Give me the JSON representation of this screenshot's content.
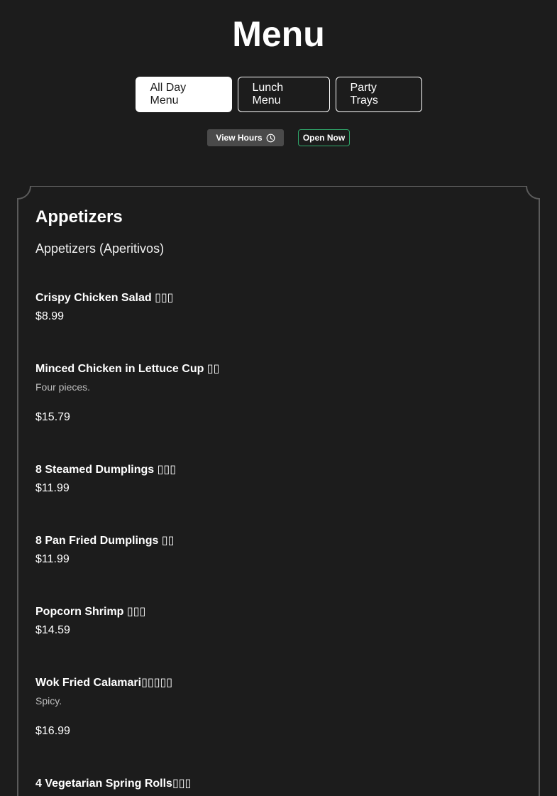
{
  "header": {
    "title": "Menu"
  },
  "tabs": [
    {
      "label": "All Day Menu",
      "active": true
    },
    {
      "label": "Lunch Menu",
      "active": false
    },
    {
      "label": "Party Trays",
      "active": false
    }
  ],
  "hours": {
    "label": "View Hours",
    "icon": "clock-icon"
  },
  "status": {
    "label": "Open Now",
    "color": "#2fa86b"
  },
  "section": {
    "title": "Appetizers",
    "subtitle": "Appetizers (Aperitivos)",
    "items": [
      {
        "name": "Crispy Chicken Salad ▯▯▯",
        "description": "",
        "price": "$8.99"
      },
      {
        "name": "Minced Chicken in Lettuce Cup ▯▯",
        "description": "Four pieces.",
        "price": "$15.79"
      },
      {
        "name": "8 Steamed Dumplings ▯▯▯",
        "description": "",
        "price": "$11.99"
      },
      {
        "name": "8 Pan Fried Dumplings ▯▯",
        "description": "",
        "price": "$11.99"
      },
      {
        "name": "Popcorn Shrimp ▯▯▯",
        "description": "",
        "price": "$14.59"
      },
      {
        "name": "Wok Fried Calamari▯▯▯▯▯",
        "description": "Spicy.",
        "price": "$16.99"
      },
      {
        "name": "4 Vegetarian Spring Rolls▯▯▯",
        "description": "",
        "price": ""
      }
    ]
  },
  "colors": {
    "background": "#1c1c1c",
    "accent": "#ffffff",
    "border": "#5a5a5a"
  }
}
